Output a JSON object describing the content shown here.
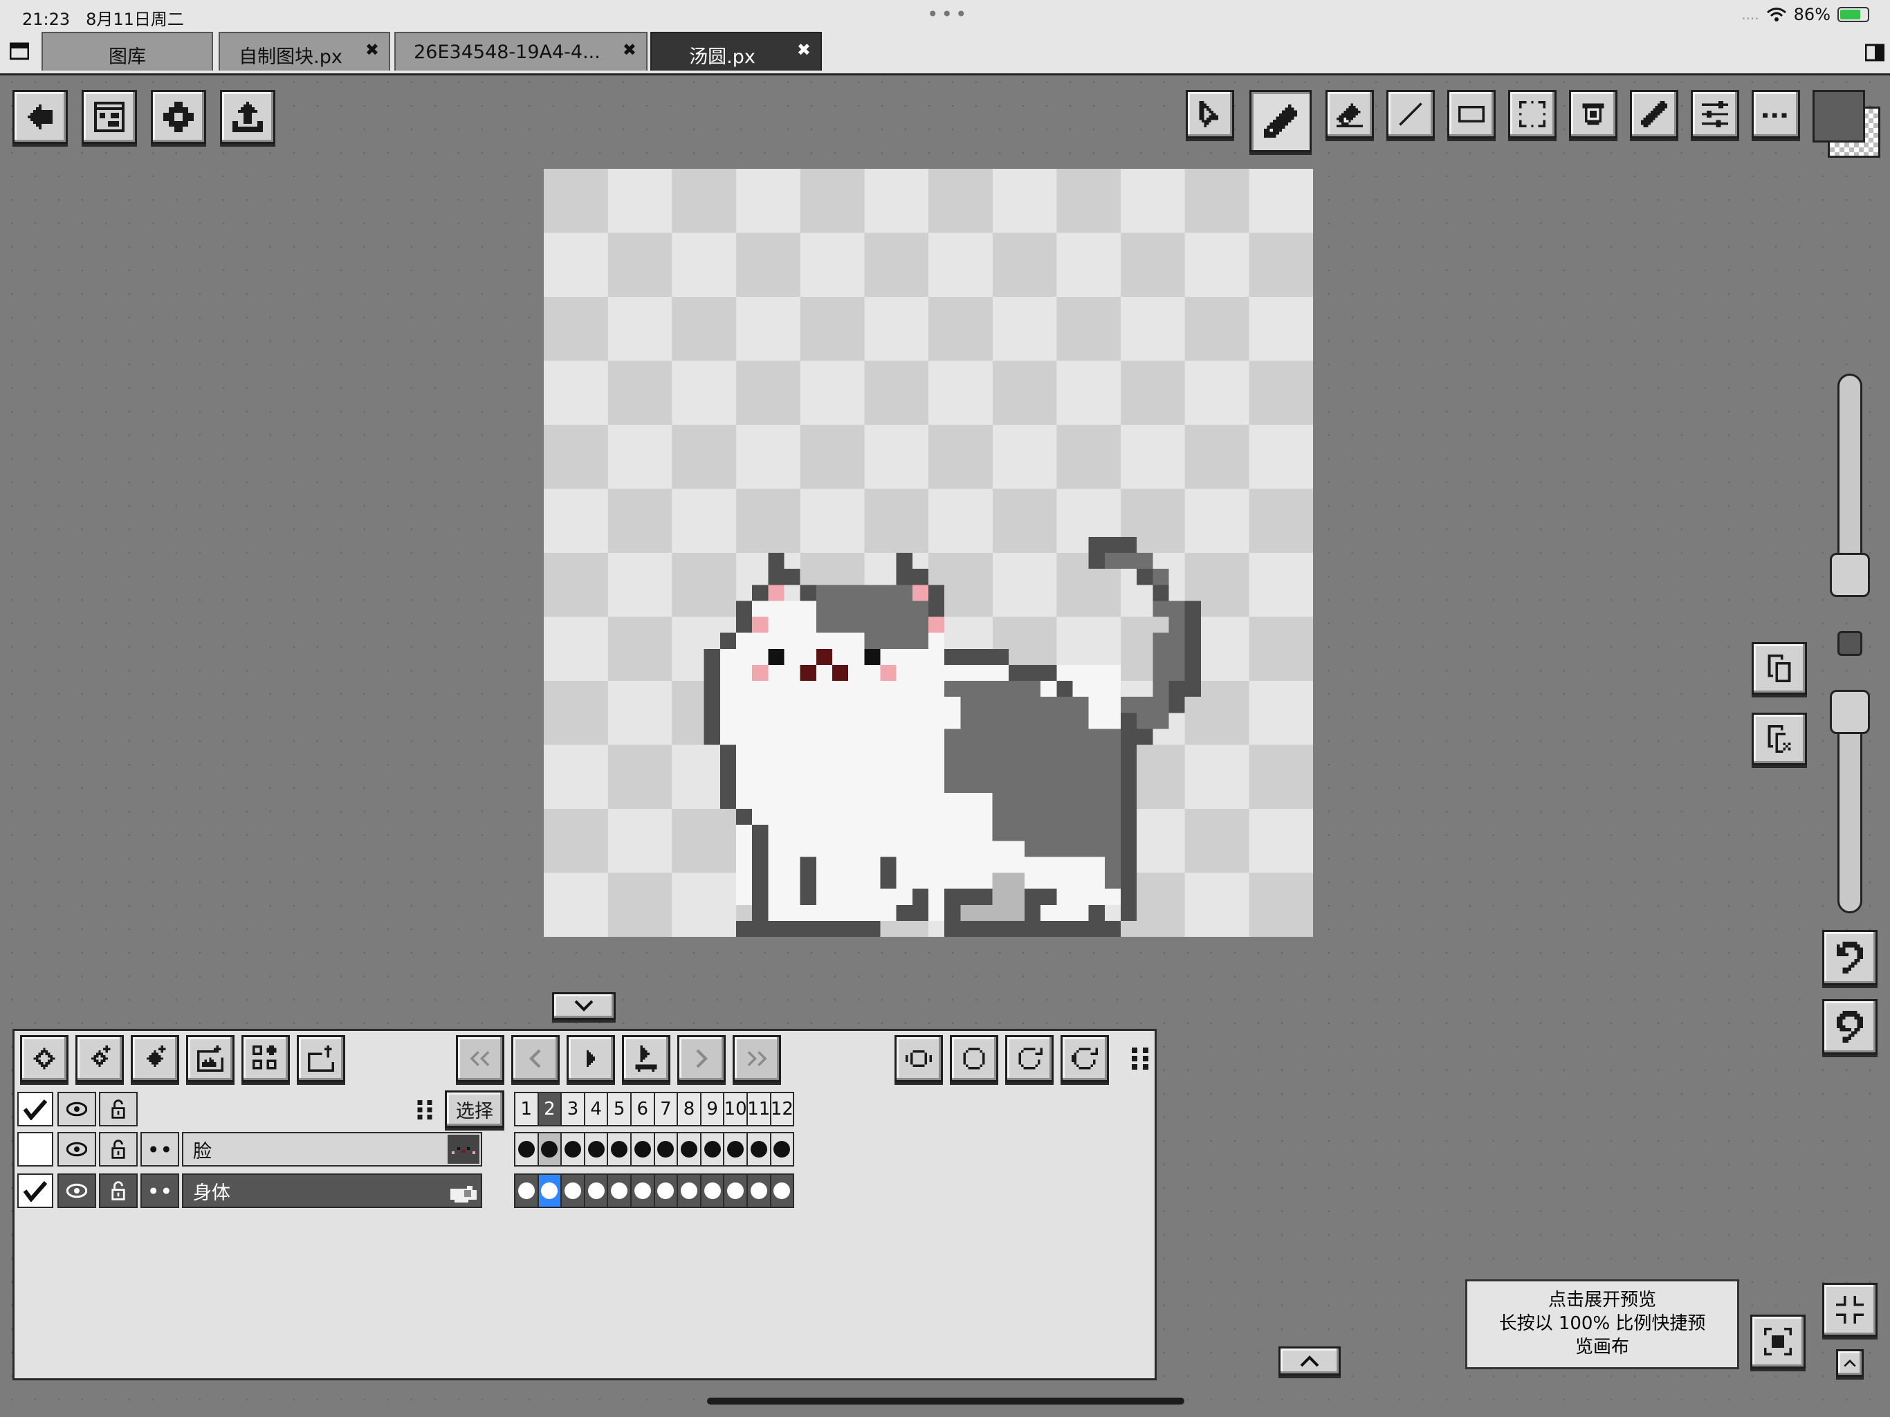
{
  "status_bar": {
    "time": "21:23",
    "date": "8月11日周二",
    "battery": "86%",
    "battery_level": 0.86
  },
  "tabs": [
    {
      "label": "图库",
      "closable": false,
      "active": false
    },
    {
      "label": "自制图块.px",
      "closable": true,
      "active": false
    },
    {
      "label": "26E34548-19A4-4...",
      "closable": true,
      "active": false
    },
    {
      "label": "汤圆.px",
      "closable": true,
      "active": true
    }
  ],
  "tab_close_glyph": "✖",
  "top_left_tools": [
    "back-icon",
    "canvas-icon",
    "settings-icon",
    "export-icon"
  ],
  "top_right_tools": [
    "select-pointer-icon",
    "pencil-icon",
    "eraser-icon",
    "line-icon",
    "rectangle-icon",
    "marquee-icon",
    "fill-bucket-icon",
    "eyedropper-icon",
    "adjust-icon",
    "more-icon"
  ],
  "active_tool": "pencil-icon",
  "colors": {
    "current": "#5e5e5e",
    "cat_dark": "#4e4e4e",
    "cat_gray": "#6f6f6f",
    "cat_white": "#f6f6f6",
    "cat_pink": "#f1a7ae",
    "cat_eye": "#111111",
    "cat_mouth": "#5a1212",
    "accent_blue": "#2f86ff",
    "panel_bg": "#e2e2e2"
  },
  "timeline": {
    "layer_tools": [
      "layer-back-icon",
      "layer-add-icon",
      "layer-merge-icon",
      "image-add-icon",
      "grid-add-icon",
      "layer-export-icon"
    ],
    "playback": [
      "first-frame-icon",
      "prev-frame-icon",
      "play-icon",
      "onion-icon",
      "next-frame-icon",
      "last-frame-icon"
    ],
    "loop_modes": [
      "loop-pingpong-icon",
      "loop-off-icon",
      "loop-once-icon",
      "loop-all-icon"
    ],
    "select_label": "选择",
    "frames": [
      "1",
      "2",
      "3",
      "4",
      "5",
      "6",
      "7",
      "8",
      "9",
      "10",
      "11",
      "12"
    ],
    "current_frame": 2,
    "layers": [
      {
        "name": "脸",
        "checked": false,
        "selected": false
      },
      {
        "name": "身体",
        "checked": true,
        "selected": true
      }
    ]
  },
  "tooltip": {
    "line1": "点击展开预览",
    "line2": "长按以 100% 比例快捷预",
    "line3": "览画布"
  }
}
